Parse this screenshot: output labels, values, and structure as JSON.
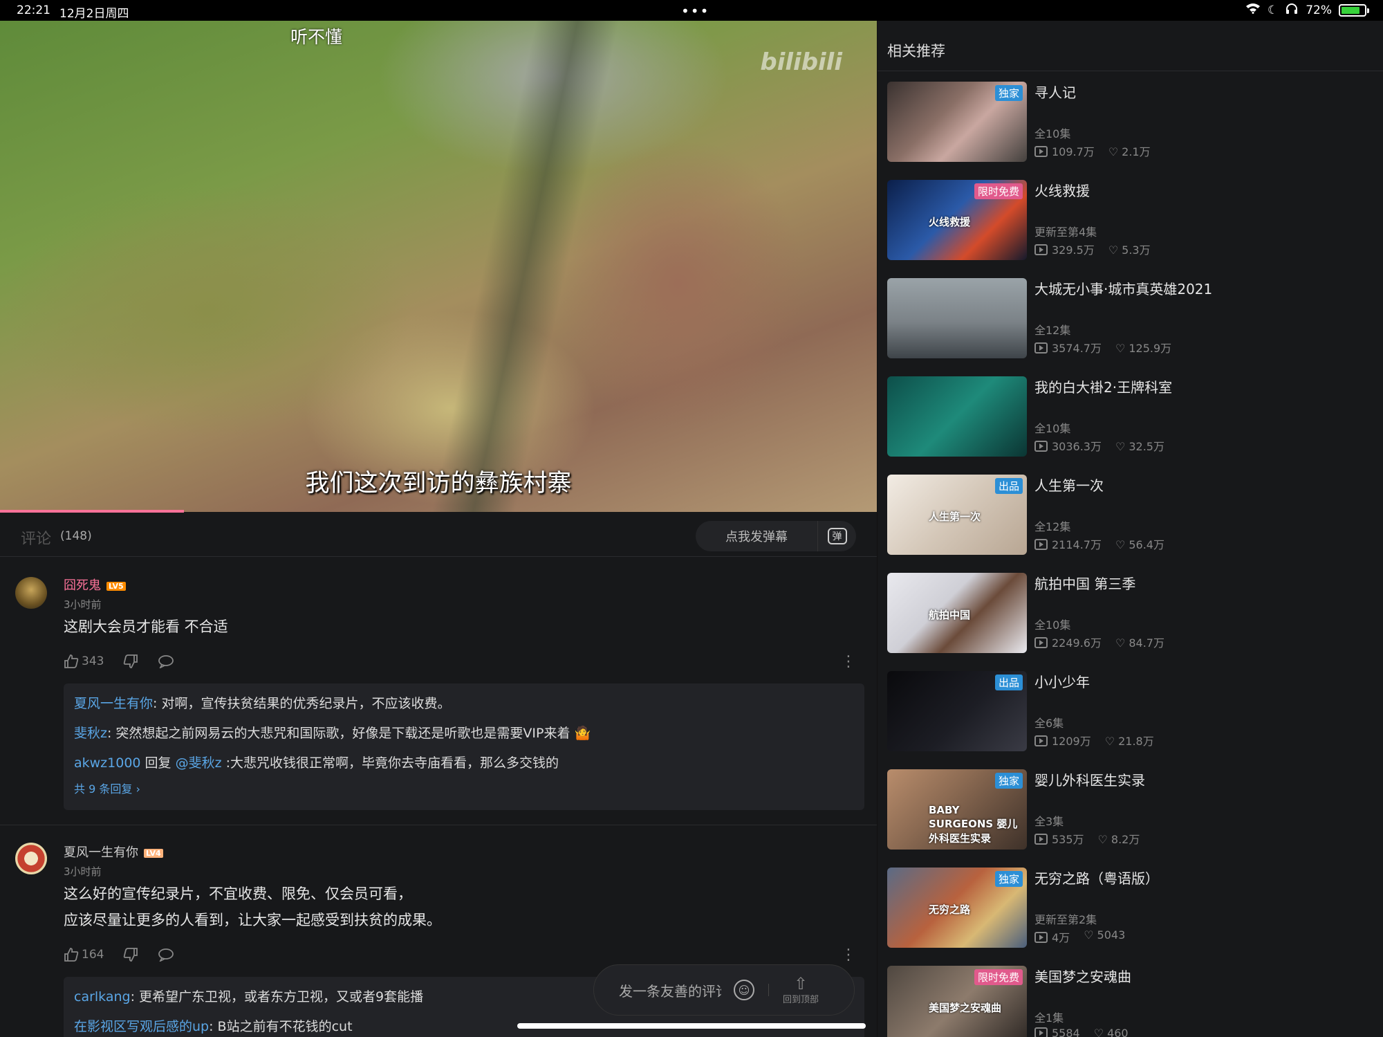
{
  "status_bar": {
    "time": "22:21",
    "date": "12月2日周四",
    "battery": "72%"
  },
  "video": {
    "top_caption": "听不懂",
    "subtitle": "我们这次到访的彝族村寨",
    "progress_fraction": 0.21
  },
  "comments_header": {
    "title": "评论",
    "count": "(148)",
    "danmaku_placeholder": "点我发弹幕",
    "danmaku_icon_label": "弹"
  },
  "comments": [
    {
      "user": "囧死鬼",
      "level": "LV5",
      "time": "3小时前",
      "text": [
        "这剧大会员才能看 不合适"
      ],
      "likes": "343",
      "replies": [
        {
          "user": "夏风一生有你",
          "text": ": 对啊，宣传扶贫结果的优秀纪录片，不应该收费。"
        },
        {
          "user": "斐秋z",
          "text": ": 突然想起之前网易云的大悲咒和国际歌，好像是下载还是听歌也是需要VIP来着 🤷"
        },
        {
          "user": "akwz1000",
          "reply_word": " 回复 ",
          "mention": "@斐秋z",
          "text": " :大悲咒收钱很正常啊，毕竟你去寺庙看看，那么多交钱的"
        }
      ],
      "total_replies": "共 9 条回复 ›"
    },
    {
      "user": "夏风一生有你",
      "level": "LV4",
      "time": "3小时前",
      "text": [
        "这么好的宣传纪录片，不宜收费、限免、仅会员可看，",
        "应该尽量让更多的人看到，让大家一起感受到扶贫的成果。"
      ],
      "likes": "164",
      "replies": [
        {
          "user": "carlkang",
          "text": ": 更希望广东卫视，或者东方卫视，又或者9套能播"
        },
        {
          "user": "在影视区写观后感的up",
          "text": ": B站之前有不花钱的cut"
        }
      ]
    }
  ],
  "float_input": {
    "placeholder": "发一条友善的评论",
    "back_to_top": "回到顶部"
  },
  "recommend": {
    "title": "相关推荐",
    "items": [
      {
        "title": "寻人记",
        "sub": "全10集",
        "plays": "109.7万",
        "likes": "2.1万",
        "badge": "独家",
        "badge_color": "#2c8fd6",
        "thumb_text": ""
      },
      {
        "title": "火线救援",
        "sub": "更新至第4集",
        "plays": "329.5万",
        "likes": "5.3万",
        "badge": "限时免费",
        "badge_color": "#e15a8c",
        "thumb_text": "火线救援"
      },
      {
        "title": "大城无小事·城市真英雄2021",
        "sub": "全12集",
        "plays": "3574.7万",
        "likes": "125.9万",
        "badge": "",
        "badge_color": "",
        "thumb_text": ""
      },
      {
        "title": "我的白大褂2·王牌科室",
        "sub": "全10集",
        "plays": "3036.3万",
        "likes": "32.5万",
        "badge": "",
        "badge_color": "",
        "thumb_text": ""
      },
      {
        "title": "人生第一次",
        "sub": "全12集",
        "plays": "2114.7万",
        "likes": "56.4万",
        "badge": "出品",
        "badge_color": "#2c8fd6",
        "thumb_text": "人生第一次"
      },
      {
        "title": "航拍中国 第三季",
        "sub": "全10集",
        "plays": "2249.6万",
        "likes": "84.7万",
        "badge": "",
        "badge_color": "",
        "thumb_text": "航拍中国"
      },
      {
        "title": "小小少年",
        "sub": "全6集",
        "plays": "1209万",
        "likes": "21.8万",
        "badge": "出品",
        "badge_color": "#2c8fd6",
        "thumb_text": ""
      },
      {
        "title": "婴儿外科医生实录",
        "sub": "全3集",
        "plays": "535万",
        "likes": "8.2万",
        "badge": "独家",
        "badge_color": "#2c8fd6",
        "thumb_text": "BABY SURGEONS 婴儿外科医生实录"
      },
      {
        "title": "无穷之路（粤语版）",
        "sub": "更新至第2集",
        "plays": "4万",
        "likes": "5043",
        "badge": "独家",
        "badge_color": "#2c8fd6",
        "thumb_text": "无穷之路"
      },
      {
        "title": "美国梦之安魂曲",
        "sub": "全1集",
        "plays": "5584",
        "likes": "460",
        "badge": "限时免费",
        "badge_color": "#e15a8c",
        "thumb_text": "美国梦之安魂曲"
      }
    ]
  }
}
